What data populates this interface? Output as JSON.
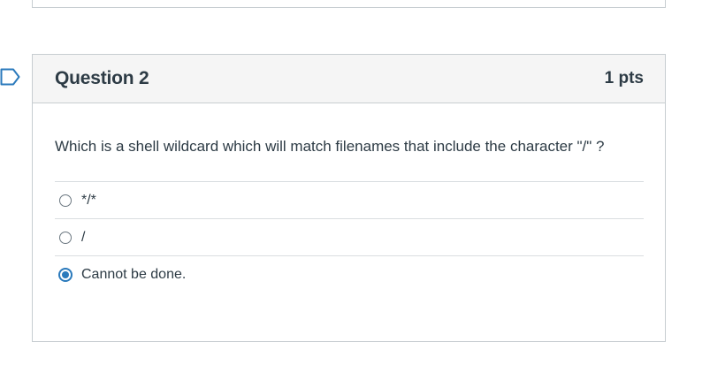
{
  "question": {
    "title": "Question 2",
    "points": "1 pts",
    "text": "Which is a shell wildcard which will match filenames that include the character \"/\" ?",
    "answers": [
      {
        "label": "*/*",
        "selected": false
      },
      {
        "label": "/",
        "selected": false
      },
      {
        "label": "Cannot be done.",
        "selected": true
      }
    ]
  },
  "colors": {
    "accent": "#2b7abc",
    "border": "#c7cdd1",
    "header_bg": "#f5f5f5",
    "text": "#2d3b45"
  },
  "icons": {
    "flag": "bookmark-flag-icon"
  }
}
